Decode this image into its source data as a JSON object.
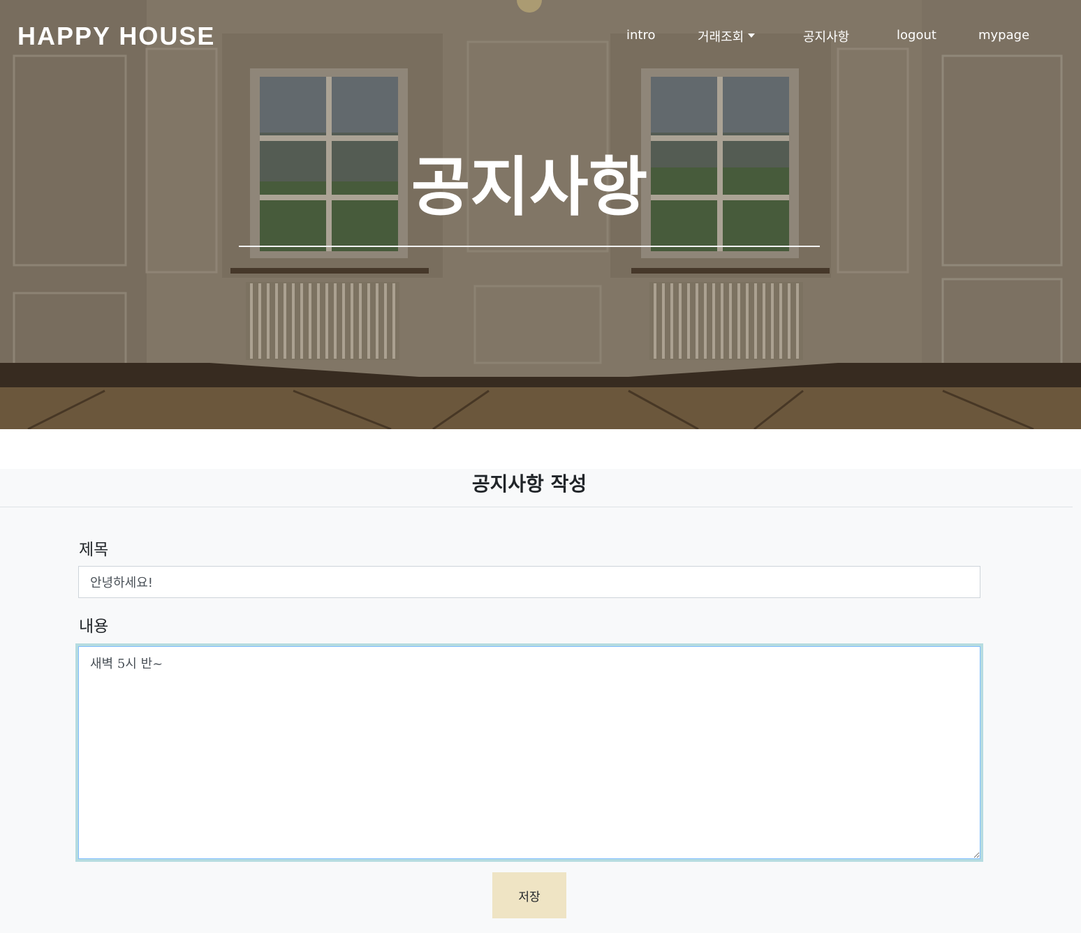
{
  "navbar": {
    "brand": "HAPPY HOUSE",
    "items": {
      "intro": "intro",
      "deals": "거래조회",
      "notice": "공지사항",
      "logout": "logout",
      "mypage": "mypage"
    }
  },
  "hero": {
    "title": "공지사항"
  },
  "form": {
    "heading": "공지사항 작성",
    "title_label": "제목",
    "title_value": "안녕하세요!",
    "content_label": "내용",
    "content_value": "새벽 5시 반~",
    "save_label": "저장"
  },
  "colors": {
    "save_button_bg": "#efe4c4",
    "content_bg": "#f8f9fa",
    "textarea_focus_ring": "#b6dce0"
  }
}
